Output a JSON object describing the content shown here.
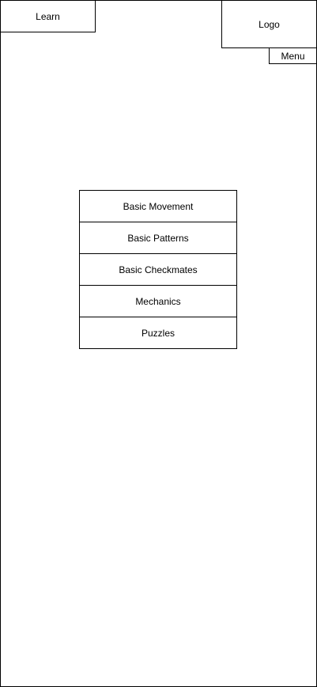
{
  "header": {
    "learn_label": "Learn",
    "logo_label": "Logo",
    "menu_label": "Menu"
  },
  "lessons": [
    {
      "label": "Basic Movement"
    },
    {
      "label": "Basic Patterns"
    },
    {
      "label": "Basic Checkmates"
    },
    {
      "label": "Mechanics"
    },
    {
      "label": "Puzzles"
    }
  ]
}
